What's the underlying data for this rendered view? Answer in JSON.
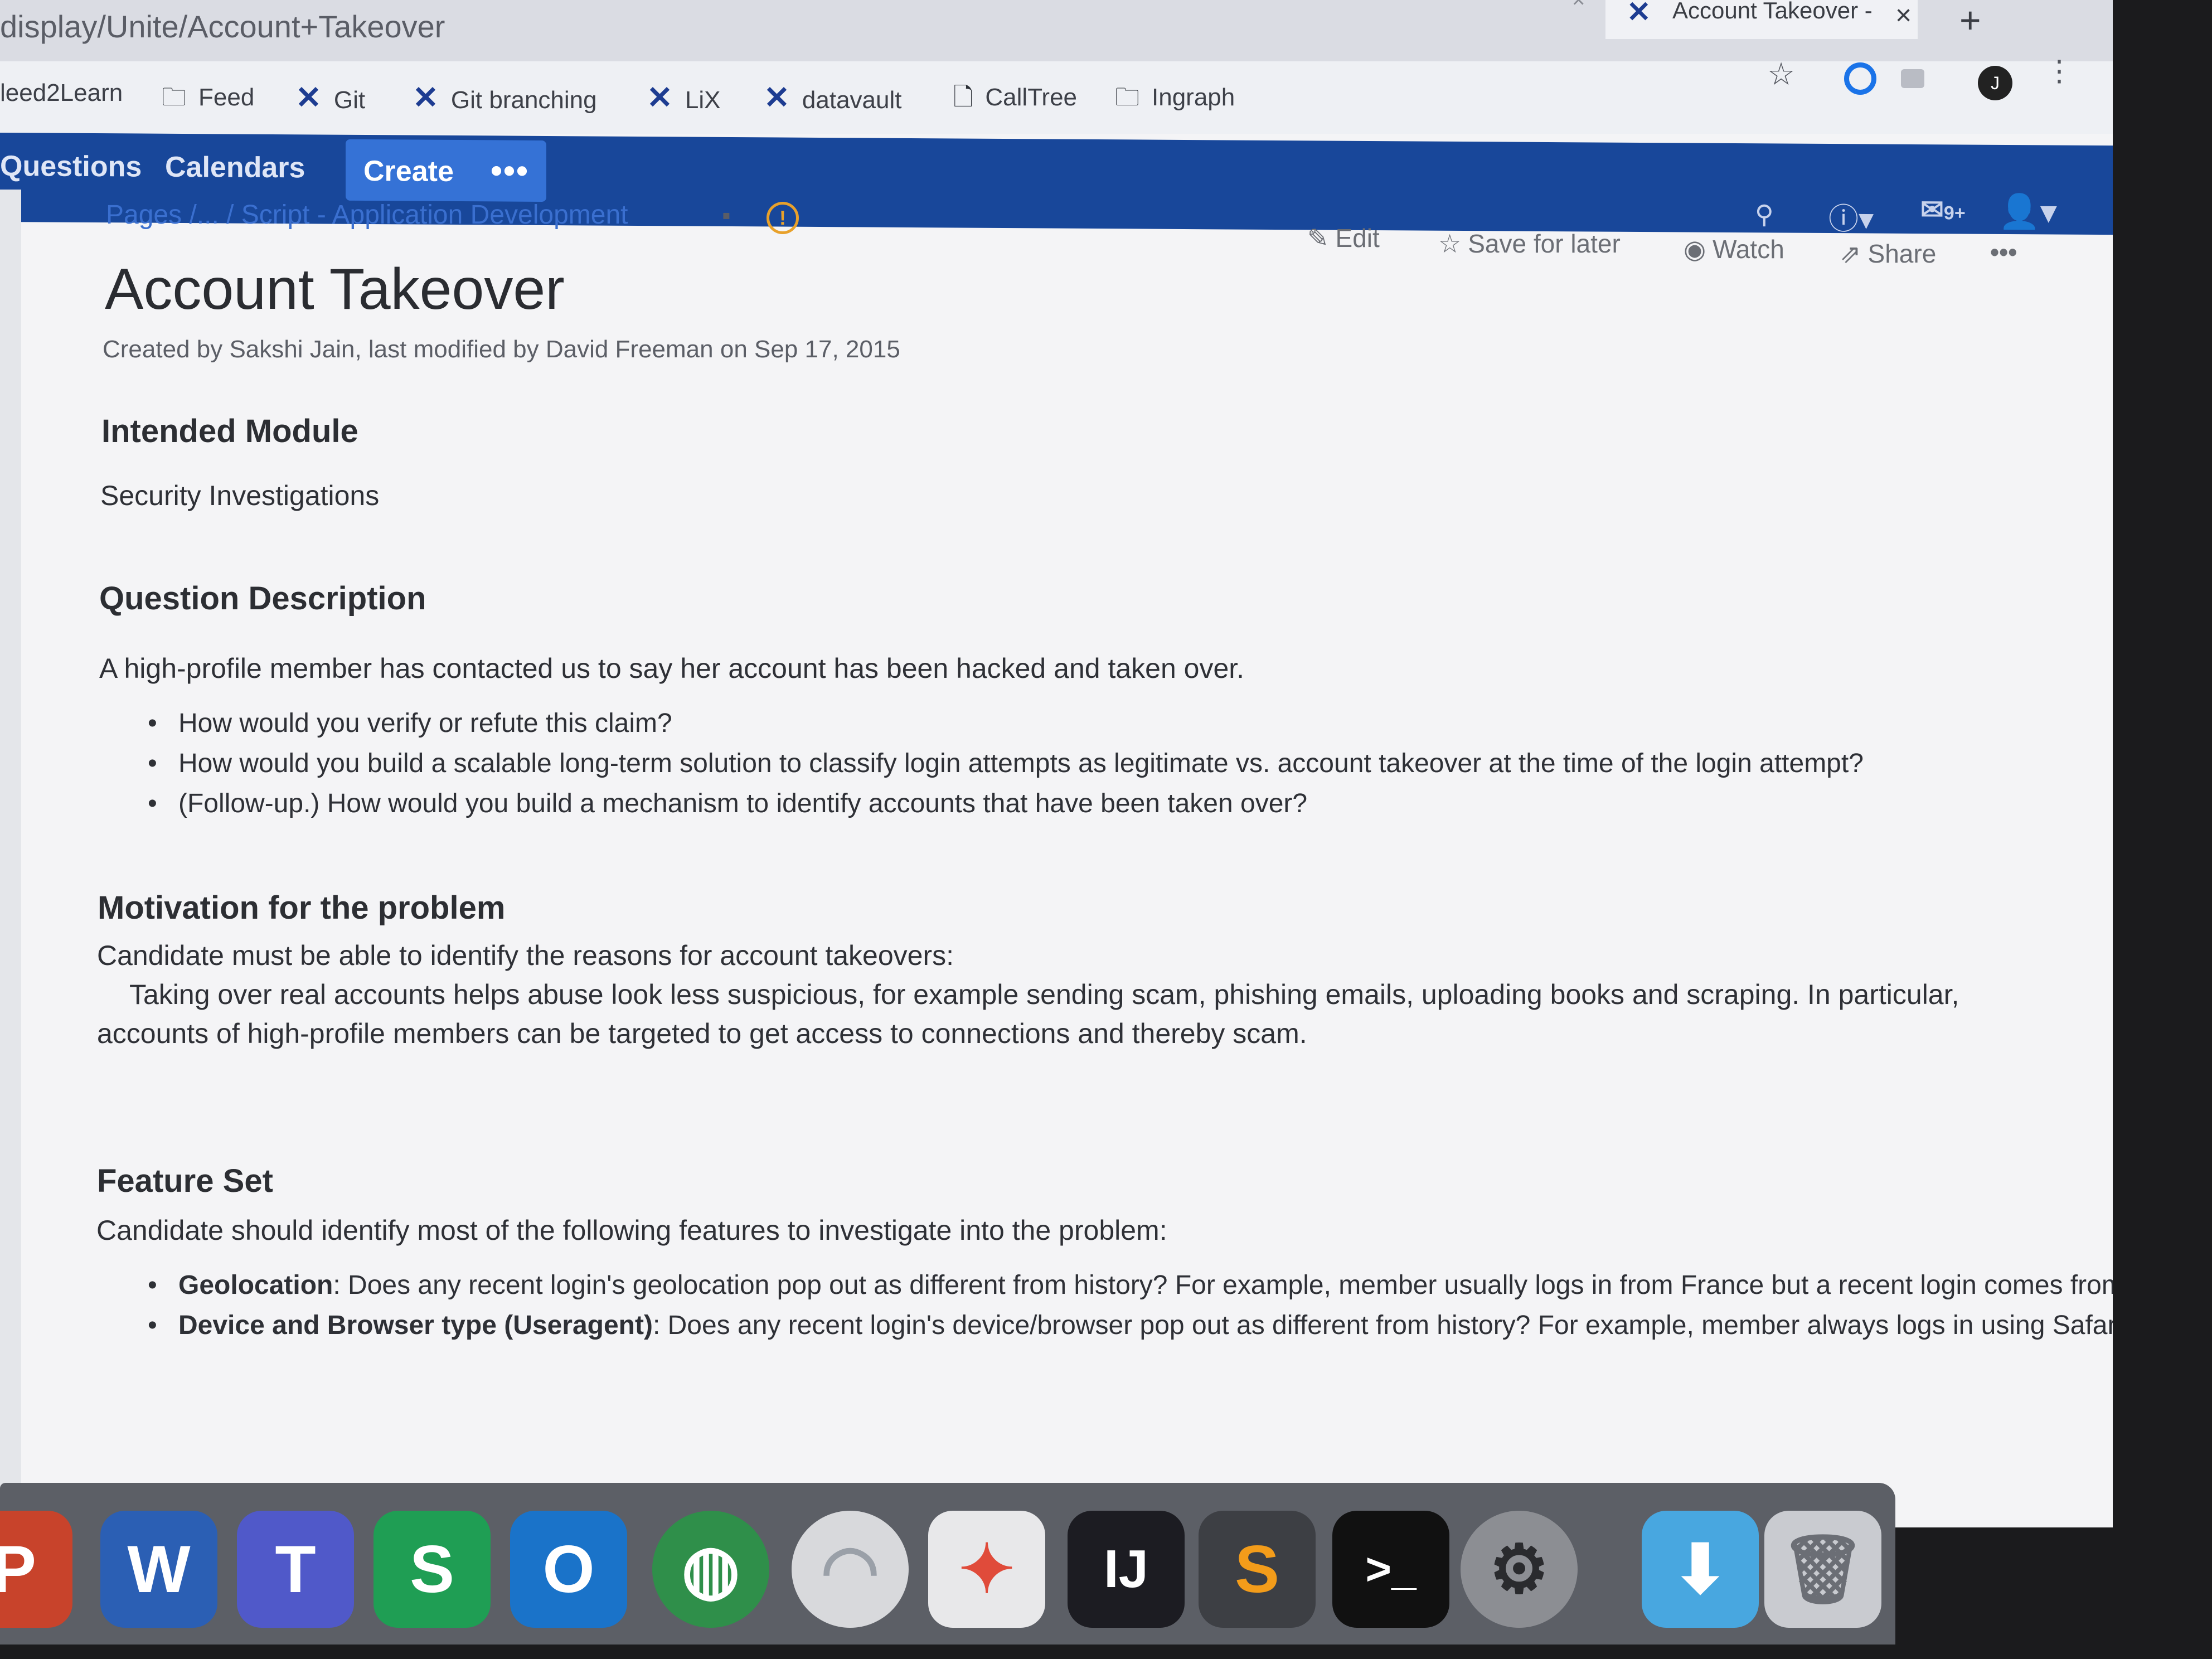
{
  "browser": {
    "url": "display/Unite/Account+Takeover",
    "tab_title": "Account Takeover - ",
    "tab_close": "×",
    "new_tab": "+",
    "bookmarks": [
      {
        "label": "leed2Learn",
        "icon": "none"
      },
      {
        "label": "Feed",
        "icon": "folder-icon"
      },
      {
        "label": "Git",
        "icon": "confluence-x-icon"
      },
      {
        "label": "Git branching",
        "icon": "confluence-x-icon"
      },
      {
        "label": "LiX",
        "icon": "confluence-x-icon"
      },
      {
        "label": "datavault",
        "icon": "confluence-x-icon"
      },
      {
        "label": "CallTree",
        "icon": "page-icon"
      },
      {
        "label": "Ingraph",
        "icon": "folder-icon"
      }
    ],
    "profile_initial": "J"
  },
  "appbar": {
    "nav": [
      "Questions",
      "Calendars"
    ],
    "create_label": "Create",
    "more_label": "•••",
    "notifications_badge": "9+"
  },
  "page": {
    "breadcrumb": "Pages /... / Script - Application Development",
    "actions": {
      "edit": "Edit",
      "save": "Save for later",
      "watch": "Watch",
      "share": "Share",
      "more": "•••"
    },
    "title": "Account Takeover",
    "byline": "Created by Sakshi Jain, last modified by David Freeman on Sep 17, 2015",
    "sections": {
      "intended_module": {
        "heading": "Intended Module",
        "text": "Security Investigations"
      },
      "question": {
        "heading": "Question Description",
        "intro": "A high-profile member has contacted us to say her account has been hacked and taken over.",
        "bullets": [
          "How would you verify or refute this claim?",
          "How would you build a scalable long-term solution to classify login attempts as legitimate vs. account takeover at the time of the login attempt?",
          "(Follow-up.) How would you build a mechanism to identify accounts that have been taken over?"
        ]
      },
      "motivation": {
        "heading": "Motivation for the problem",
        "line1": "Candidate must be able to identify the reasons for account takeovers:",
        "line2": "Taking over real accounts helps abuse look less suspicious, for example sending scam, phishing emails, uploading books and scraping.  In particular,",
        "line3": "accounts of high-profile members can be targeted to get access to connections and thereby scam."
      },
      "features": {
        "heading": "Feature Set",
        "intro": "Candidate should identify most of the following features to investigate into the problem:",
        "items": [
          {
            "label": "Geolocation",
            "text": ": Does any recent login's geolocation pop out as different from history? For example, member usually logs in from France but a recent login comes from Nigeria. Reputation of the geo-location in terms of abuse seen in the past across LinkedInDo the hacked accounts share a common login IP address or country?  Reputation of the geo-location in terms of abuse seen in the past across LinkedIn"
          },
          {
            "label": "Device and Browser type (Useragent)",
            "text": ": Does any recent login's device/browser pop out as different from history? For example, member always logs in using Safari from Mac, but the most recent access was from Internet Explorer on Windows machine. Reputation of the browser or device in terms of abuse seen in the past across LinkedIn"
          }
        ]
      }
    }
  },
  "dock": {
    "apps": [
      {
        "name": "powerpoint",
        "glyph": "P",
        "color": "#c8432b"
      },
      {
        "name": "word",
        "glyph": "W",
        "color": "#2b5fb4"
      },
      {
        "name": "teams",
        "glyph": "T",
        "color": "#5059c9"
      },
      {
        "name": "skype-for-business",
        "glyph": "S",
        "color": "#1f9e54"
      },
      {
        "name": "outlook",
        "glyph": "O",
        "color": "#1a73c9"
      },
      {
        "name": "vpn-client",
        "glyph": "◍",
        "color": "#2f8f4a"
      },
      {
        "name": "wifi-utility",
        "glyph": "◠",
        "color": "#d8d9dc"
      },
      {
        "name": "slack-like",
        "glyph": "✦",
        "color": "#e8e8ea"
      },
      {
        "name": "intellij",
        "glyph": "IJ",
        "color": "#1c1c22"
      },
      {
        "name": "sublime-text",
        "glyph": "S",
        "color": "#3d3f44"
      },
      {
        "name": "terminal",
        "glyph": ">_",
        "color": "#111111"
      },
      {
        "name": "system-preferences",
        "glyph": "⚙",
        "color": "#8c8e93"
      },
      {
        "name": "downloads-folder",
        "glyph": "⬇",
        "color": "#48a7e0"
      },
      {
        "name": "trash",
        "glyph": "🗑",
        "color": "#c9cbd0"
      }
    ]
  }
}
